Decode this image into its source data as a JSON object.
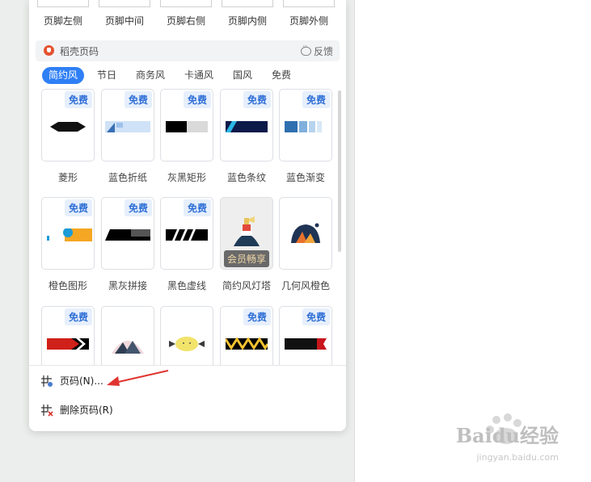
{
  "footer_positions": [
    "页脚左侧",
    "页脚中间",
    "页脚右侧",
    "页脚内侧",
    "页脚外侧"
  ],
  "section": {
    "title": "稻壳页码",
    "feedback": "反馈"
  },
  "tabs": [
    "简约风",
    "节日",
    "商务风",
    "卡通风",
    "国风",
    "免费"
  ],
  "active_tab": "简约风",
  "badge_free": "免费",
  "badge_vip": "会员畅享",
  "templates": [
    {
      "name": "菱形",
      "free": true
    },
    {
      "name": "蓝色折纸",
      "free": true
    },
    {
      "name": "灰黑矩形",
      "free": true
    },
    {
      "name": "蓝色条纹",
      "free": true
    },
    {
      "name": "蓝色渐变",
      "free": true
    },
    {
      "name": "橙色图形",
      "free": true
    },
    {
      "name": "黑灰拼接",
      "free": true
    },
    {
      "name": "黑色虚线",
      "free": true
    },
    {
      "name": "简约风灯塔",
      "free": false
    },
    {
      "name": "几何风橙色",
      "free": false
    },
    {
      "name": "",
      "free": true
    },
    {
      "name": "",
      "free": false
    },
    {
      "name": "",
      "free": false
    },
    {
      "name": "",
      "free": true
    },
    {
      "name": "",
      "free": true
    }
  ],
  "menu": {
    "page_number": "页码(N)...",
    "delete_page_number": "删除页码(R)"
  },
  "watermark": {
    "main": "Baidu经验",
    "sub": "jingyan.baidu.com"
  },
  "colors": {
    "accent": "#2f7ff5",
    "arrow": "#e0342f"
  }
}
